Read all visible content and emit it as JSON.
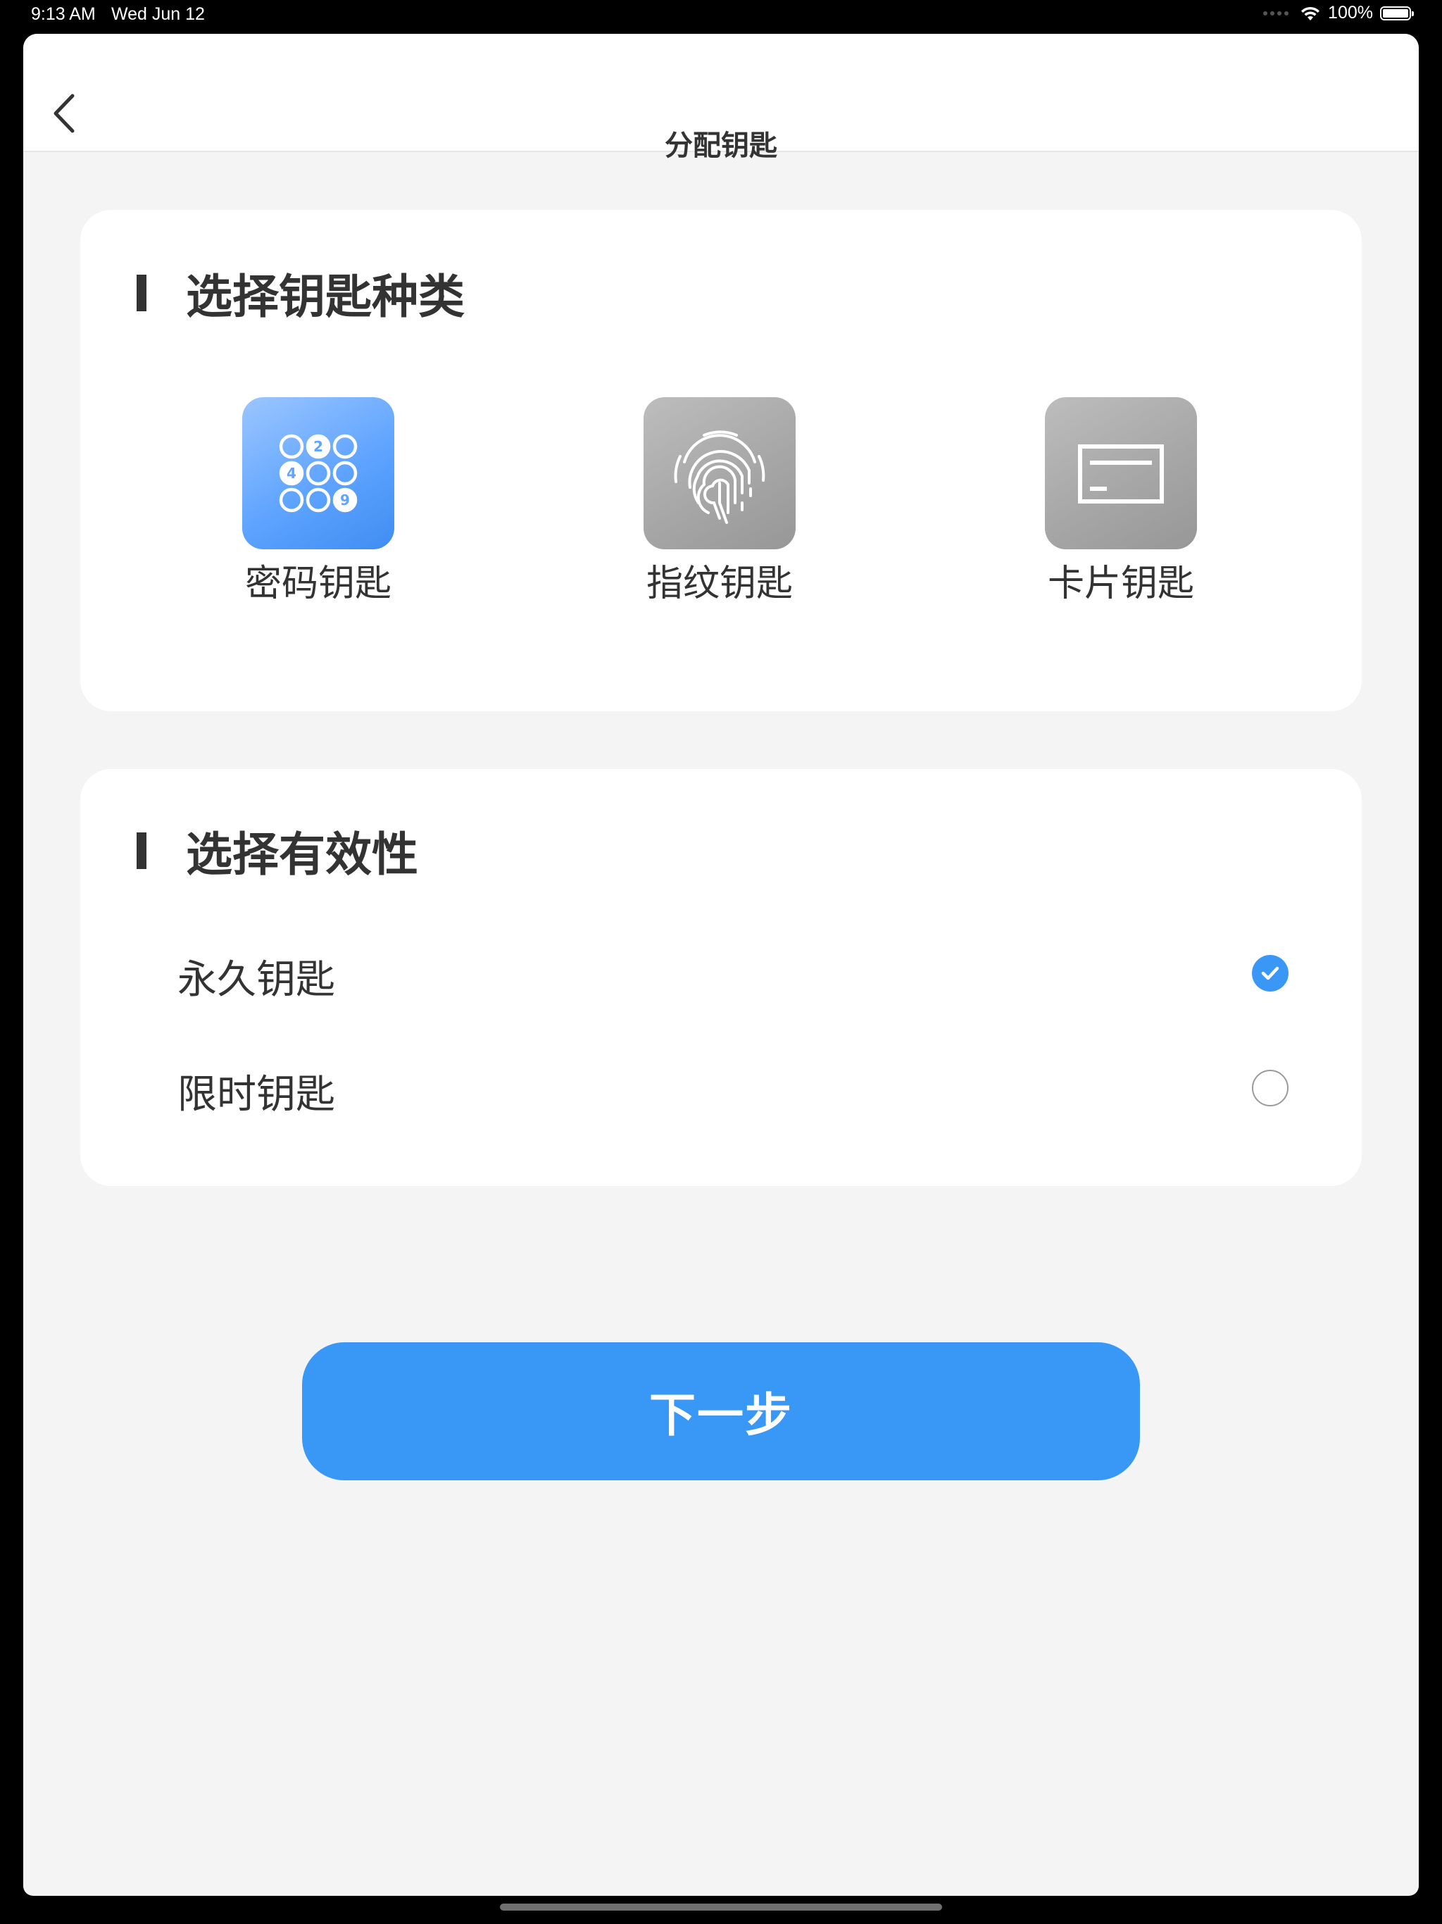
{
  "status_bar": {
    "time": "9:13 AM",
    "date": "Wed Jun 12",
    "battery": "100%",
    "battery_level": 1.0,
    "wifi_icon": "wifi-icon",
    "battery_icon": "battery-icon"
  },
  "nav": {
    "title": "分配钥匙",
    "back_icon": "chevron-left-icon"
  },
  "key_type_section": {
    "title": "选择钥匙种类",
    "options": [
      {
        "label": "密码钥匙",
        "icon": "keypad-icon",
        "selected": true
      },
      {
        "label": "指纹钥匙",
        "icon": "fingerprint-icon",
        "selected": false
      },
      {
        "label": "卡片钥匙",
        "icon": "card-icon",
        "selected": false
      }
    ]
  },
  "validity_section": {
    "title": "选择有效性",
    "options": [
      {
        "label": "永久钥匙",
        "checked": true
      },
      {
        "label": "限时钥匙",
        "checked": false
      }
    ]
  },
  "next_button": {
    "label": "下一步"
  },
  "colors": {
    "accent": "#3997f6",
    "background": "#f4f4f4",
    "card": "#ffffff",
    "text": "#333333",
    "inactive_icon": "#a7a7a7"
  }
}
